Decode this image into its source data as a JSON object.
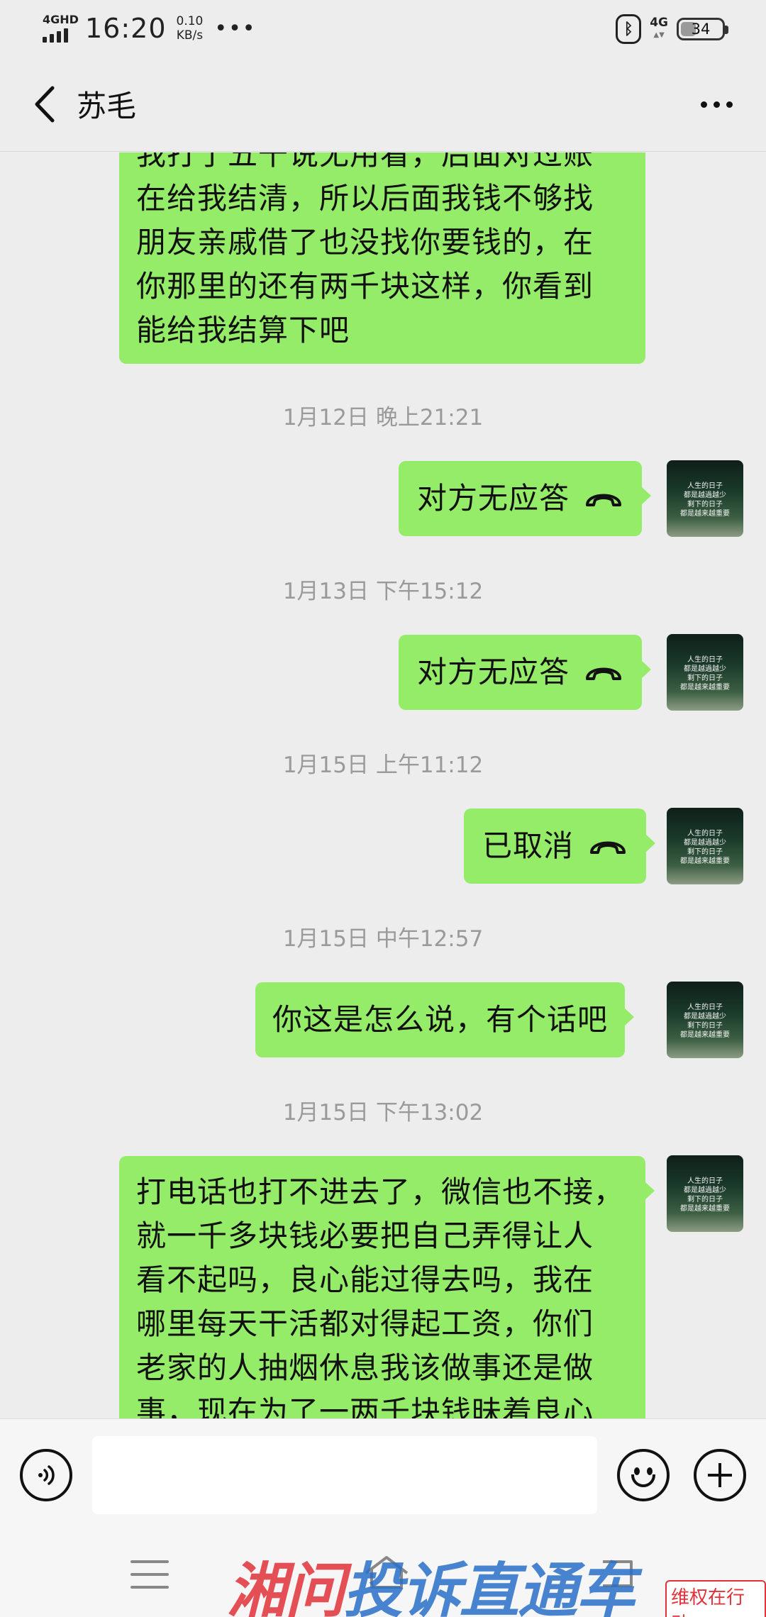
{
  "status_bar": {
    "network": "4GHD",
    "time": "16:20",
    "speed_value": "0.10",
    "speed_unit": "KB/s",
    "more": "•••",
    "bluetooth": "ᛒ",
    "signal_4g": "4G",
    "battery": "34"
  },
  "header": {
    "title": "苏毛"
  },
  "messages": [
    {
      "type": "text",
      "lines": [
        "我打了五千说无用看，后面对过账",
        "在给我结清，所以后面我钱不够找",
        "朋友亲戚借了也没找你要钱的，在",
        "你那里的还有两千块这样，你看到",
        "能给我结算下吧"
      ]
    },
    {
      "type": "timestamp",
      "text": "1月12日 晚上21:21"
    },
    {
      "type": "call",
      "label": "对方无应答"
    },
    {
      "type": "timestamp",
      "text": "1月13日 下午15:12"
    },
    {
      "type": "call",
      "label": "对方无应答"
    },
    {
      "type": "timestamp",
      "text": "1月15日 上午11:12"
    },
    {
      "type": "call",
      "label": "已取消"
    },
    {
      "type": "timestamp",
      "text": "1月15日 中午12:57"
    },
    {
      "type": "text",
      "lines": [
        "你这是怎么说，有个话吧"
      ]
    },
    {
      "type": "timestamp",
      "text": "1月15日 下午13:02"
    },
    {
      "type": "text",
      "lines": [
        "打电话也打不进去了，微信也不接，",
        "就一千多块钱必要把自己弄得让人",
        "看不起吗，良心能过得去吗，我在",
        "哪里每天干活都对得起工资，你们",
        "老家的人抽烟休息我该做事还是做",
        "事，现在为了一两千块钱昧着良心"
      ]
    }
  ],
  "avatar": {
    "lines": [
      "人生的日子",
      "都是越過越少",
      "剩下的日子",
      "都是越来越重要"
    ]
  },
  "input": {
    "placeholder": ""
  },
  "watermark": {
    "part_a": "湘问",
    "part_b": "投诉直通车",
    "stamp": "维权在行动"
  },
  "colors": {
    "bubble": "#95ec69",
    "background": "#ededed",
    "timestamp": "#9a9a9a"
  }
}
